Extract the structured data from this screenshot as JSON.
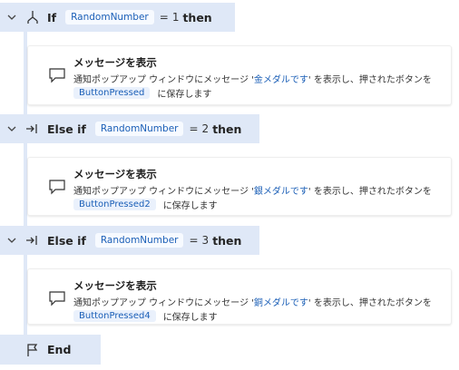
{
  "blocks": [
    {
      "keyword": "If",
      "variable": "RandomNumber",
      "operator": "=",
      "value": "1",
      "then_label": "then",
      "action": {
        "title": "メッセージを表示",
        "text_before": "通知ポップアップ ウィンドウにメッセージ '",
        "message": "金メダルです",
        "text_after": "' を表示し、押されたボタンを",
        "output_var": "ButtonPressed",
        "save_suffix": "に保存します"
      }
    },
    {
      "keyword": "Else if",
      "variable": "RandomNumber",
      "operator": "=",
      "value": "2",
      "then_label": "then",
      "action": {
        "title": "メッセージを表示",
        "text_before": "通知ポップアップ ウィンドウにメッセージ '",
        "message": "銀メダルです",
        "text_after": "' を表示し、押されたボタンを",
        "output_var": "ButtonPressed2",
        "save_suffix": "に保存します"
      }
    },
    {
      "keyword": "Else if",
      "variable": "RandomNumber",
      "operator": "=",
      "value": "3",
      "then_label": "then",
      "action": {
        "title": "メッセージを表示",
        "text_before": "通知ポップアップ ウィンドウにメッセージ '",
        "message": "銅メダルです",
        "text_after": "' を表示し、押されたボタンを",
        "output_var": "ButtonPressed4",
        "save_suffix": "に保存します"
      }
    }
  ],
  "end_label": "End",
  "icons": {
    "if": "if-branch-icon",
    "else_if": "else-if-branch-icon",
    "message": "message-box-icon",
    "end": "end-flag-icon",
    "collapse": "chevron-down-icon"
  },
  "colors": {
    "header_bg": "#dfe8f7",
    "variable_text": "#1b5fb7",
    "variable_chip_bg": "#eaf1fc"
  }
}
